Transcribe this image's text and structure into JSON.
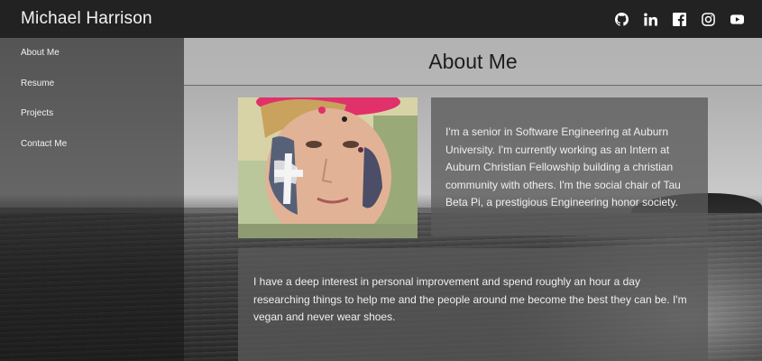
{
  "header": {
    "name": "Michael Harrison",
    "socials": [
      {
        "icon": "github-icon",
        "label": "GitHub"
      },
      {
        "icon": "linkedin-icon",
        "label": "LinkedIn"
      },
      {
        "icon": "facebook-icon",
        "label": "Facebook"
      },
      {
        "icon": "instagram-icon",
        "label": "Instagram"
      },
      {
        "icon": "youtube-icon",
        "label": "YouTube"
      }
    ]
  },
  "sidebar": {
    "items": [
      {
        "label": "About Me"
      },
      {
        "label": "Resume"
      },
      {
        "label": "Projects"
      },
      {
        "label": "Contact Me"
      }
    ]
  },
  "main": {
    "title": "About Me",
    "bio": "I'm a senior in Software Engineering at Auburn University. I'm currently working as an Intern at Auburn Christian Fellowship building a christian community with others. I'm the social chair of Tau Beta Pi, a prestigious Engineering honor society.",
    "interest": "I have a deep interest in personal improvement and spend roughly an hour a day researching things to help me and the people around me become the best they can be. I'm vegan and never wear shoes."
  },
  "colors": {
    "topbar": "#222222",
    "sidebar": "rgba(20,20,20,0.55)",
    "card": "rgba(90,90,90,0.78)",
    "page_head": "rgba(185,185,185,0.72)"
  }
}
